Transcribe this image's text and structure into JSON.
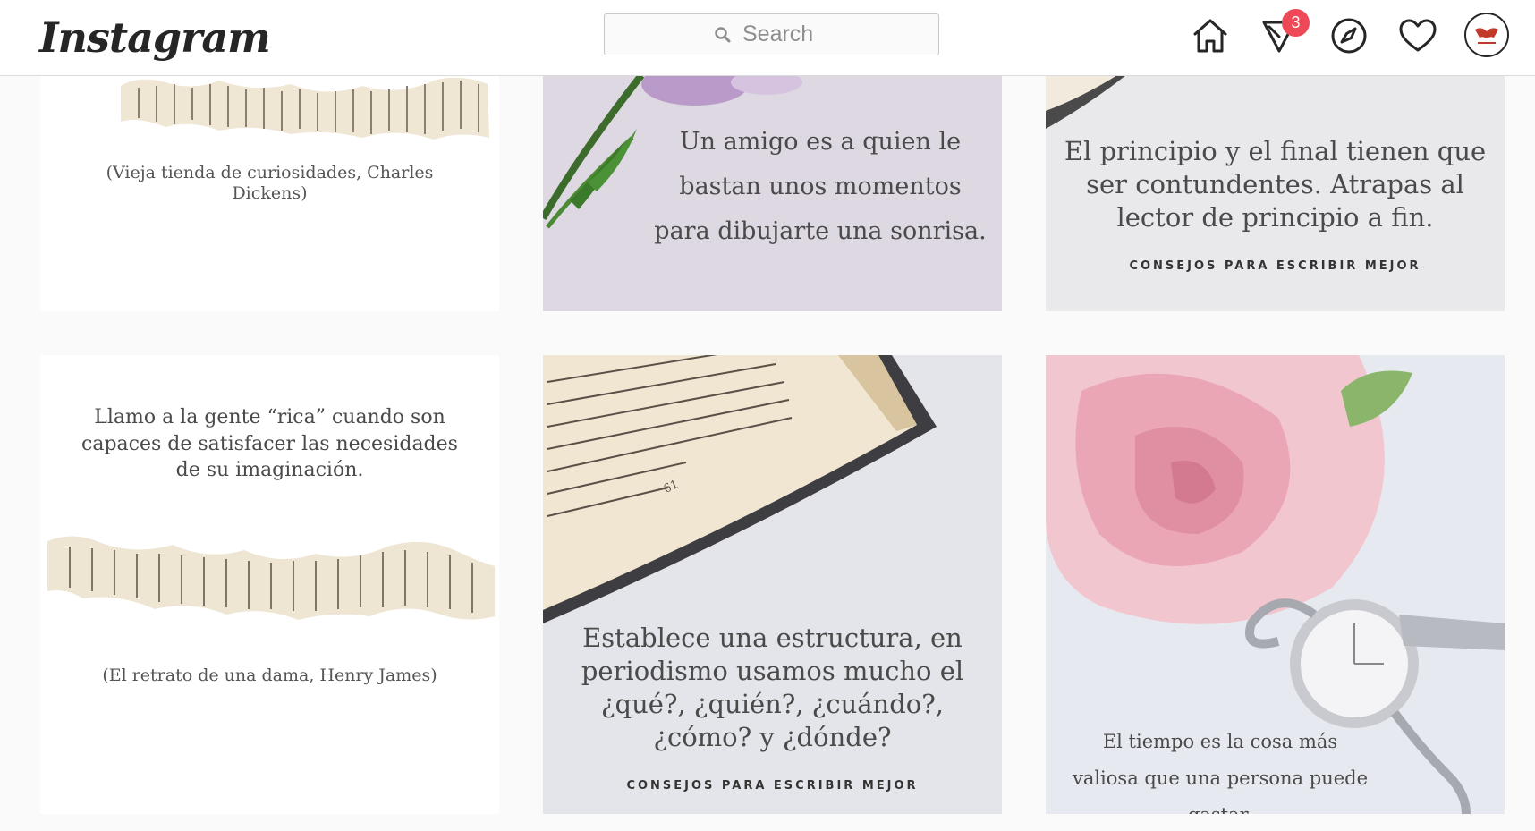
{
  "header": {
    "logo": "Instagram",
    "search_placeholder": "Search",
    "direct_badge": "3"
  },
  "icons": [
    "search-icon",
    "home-icon",
    "direct-icon",
    "explore-icon",
    "heart-icon",
    "avatar"
  ],
  "colors": {
    "badge": "#ed4956",
    "text": "#262626",
    "border": "#dbdbdb"
  },
  "posts": [
    {
      "caption": "(Vieja tienda de curiosidades, Charles Dickens)"
    },
    {
      "quote": "Un amigo es a quien le bastan unos momentos para dibujarte una sonrisa."
    },
    {
      "quote": "El principio y el final tienen que ser contundentes. Atrapas al lector de principio a fin.",
      "label": "CONSEJOS PARA ESCRIBIR MEJOR"
    },
    {
      "quote": "Llamo a la gente “rica” cuando son capaces de satisfacer las necesidades de su imaginación.",
      "caption": "(El retrato de una dama, Henry James)"
    },
    {
      "quote": "Establece una estructura, en periodismo usamos mucho el ¿qué?, ¿quién?, ¿cuándo?, ¿cómo? y ¿dónde?",
      "label": "CONSEJOS PARA ESCRIBIR MEJOR",
      "page_number": "61"
    },
    {
      "quote": "El tiempo es la cosa más valiosa que una persona puede gastar."
    }
  ]
}
